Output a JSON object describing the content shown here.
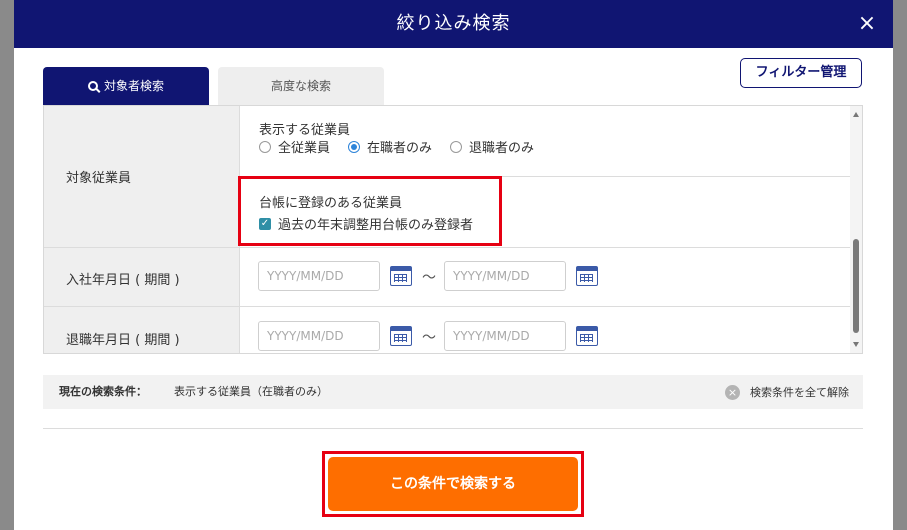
{
  "header": {
    "title": "絞り込み検索",
    "close_symbol": "×"
  },
  "tabs": [
    {
      "label": "対象者検索",
      "active": true
    },
    {
      "label": "高度な検索",
      "active": false
    }
  ],
  "filter_manage_label": "フィルター管理",
  "target_employees": {
    "row_label": "対象従業員",
    "display_title": "表示する従業員",
    "options": [
      {
        "label": "全従業員",
        "checked": false
      },
      {
        "label": "在職者のみ",
        "checked": true
      },
      {
        "label": "退職者のみ",
        "checked": false
      }
    ],
    "ledger_title": "台帳に登録のある従業員",
    "ledger_checkbox_label": "過去の年末調整用台帳のみ登録者",
    "ledger_checked": true
  },
  "join_date": {
    "row_label": "入社年月日 ( 期間 )",
    "from_placeholder": "YYYY/MM/DD",
    "to_placeholder": "YYYY/MM/DD",
    "separator": "〜"
  },
  "leave_date": {
    "row_label": "退職年月日 ( 期間 )",
    "from_placeholder": "YYYY/MM/DD",
    "to_placeholder": "YYYY/MM/DD",
    "separator": "〜"
  },
  "current_conditions": {
    "label": "現在の検索条件：",
    "value": "表示する従業員（在職者のみ）",
    "clear_label": "検索条件を全て解除"
  },
  "search_button_label": "この条件で検索する",
  "colors": {
    "header": "#101572",
    "accent": "#fe6e00",
    "highlight": "#e60012"
  }
}
